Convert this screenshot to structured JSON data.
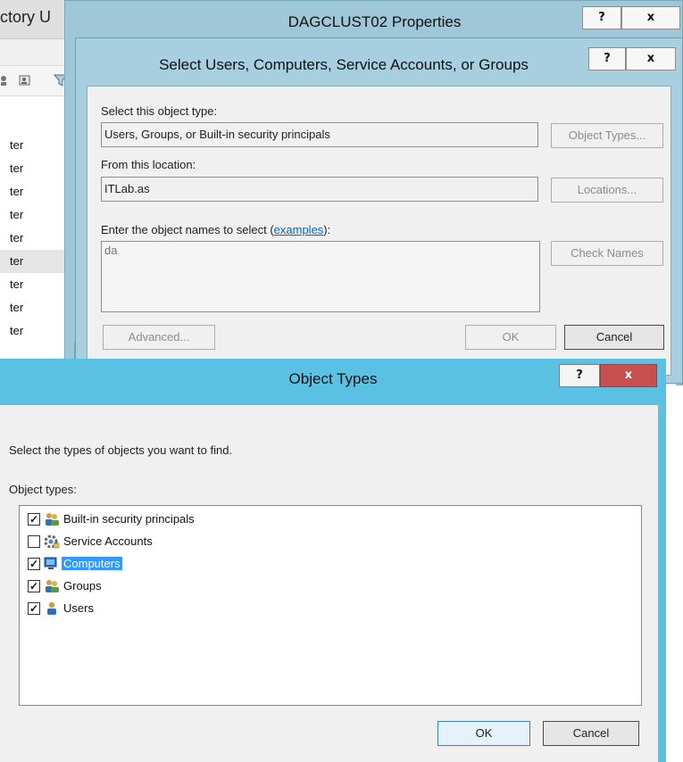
{
  "ad_window": {
    "title": "ctory U",
    "rows": [
      "ter",
      "ter",
      "ter",
      "ter",
      "ter",
      "ter",
      "ter",
      "ter",
      "ter"
    ]
  },
  "properties_window": {
    "title": "DAGCLUST02 Properties",
    "help_label": "?",
    "close_label": "x"
  },
  "select_dialog": {
    "title": "Select Users, Computers, Service Accounts, or Groups",
    "help_label": "?",
    "close_label": "x",
    "object_type_label": "Select this object type:",
    "object_type_value": "Users, Groups, or Built-in security principals",
    "object_types_button": "Object Types...",
    "location_label": "From this location:",
    "location_value": "ITLab.as",
    "locations_button": "Locations...",
    "names_label_prefix": "Enter the object names to select (",
    "names_label_link": "examples",
    "names_label_suffix": "):",
    "names_value": "da",
    "check_names_button": "Check Names",
    "advanced_button": "Advanced...",
    "ok_button": "OK",
    "cancel_button": "Cancel"
  },
  "object_types_dialog": {
    "title": "Object Types",
    "help_label": "?",
    "close_label": "x",
    "close_color": "#c75050",
    "titlebar_color": "#5bc1e3",
    "instruction": "Select the types of objects you want to find.",
    "list_label": "Object types:",
    "items": [
      {
        "label": "Built-in security principals",
        "checked": true,
        "icon": "users-group-icon"
      },
      {
        "label": "Service Accounts",
        "checked": false,
        "icon": "service-gear-icon"
      },
      {
        "label": "Computers",
        "checked": true,
        "selected": true,
        "icon": "computer-icon"
      },
      {
        "label": "Groups",
        "checked": true,
        "icon": "users-group-icon"
      },
      {
        "label": "Users",
        "checked": true,
        "icon": "user-icon"
      }
    ],
    "ok_button": "OK",
    "cancel_button": "Cancel"
  }
}
